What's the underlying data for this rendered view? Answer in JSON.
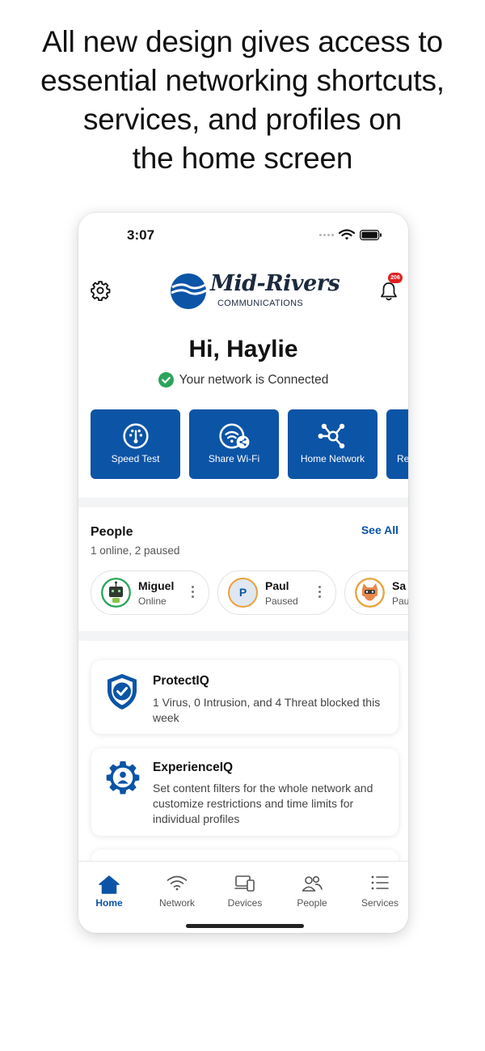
{
  "headline": {
    "lines": [
      "All new design gives access to",
      "essential networking shortcuts,",
      "services, and profiles on",
      "the home screen"
    ]
  },
  "status_bar": {
    "time": "3:07",
    "icons": [
      "signal-dots-icon",
      "wifi-icon",
      "battery-icon"
    ]
  },
  "header": {
    "settings_icon": "gear-icon",
    "logo_text": "Mid-Rivers",
    "logo_subtext": "COMMUNICATIONS",
    "notification_icon": "bell-icon",
    "notification_count": "206"
  },
  "greeting": {
    "title": "Hi, Haylie",
    "network_status": "Your network is Connected",
    "status_icon": "check-circle-icon"
  },
  "shortcuts": [
    {
      "label": "Speed Test",
      "icon": "speedometer-icon"
    },
    {
      "label": "Share Wi-Fi",
      "icon": "share-wifi-icon"
    },
    {
      "label": "Home Network",
      "icon": "network-hub-icon"
    },
    {
      "label": "Re",
      "icon": "partial-tile-icon"
    }
  ],
  "people": {
    "title": "People",
    "see_all": "See All",
    "summary": "1 online, 2 paused",
    "profiles": [
      {
        "name": "Miguel",
        "status": "Online",
        "avatar": "robot-avatar-icon"
      },
      {
        "name": "Paul",
        "status": "Paused",
        "avatar": "initial-avatar",
        "initial": "P"
      },
      {
        "name": "Sa",
        "status": "Pau",
        "avatar": "cat-avatar-icon"
      }
    ]
  },
  "services": [
    {
      "title": "ProtectIQ",
      "description": "1 Virus, 0 Intrusion, and 4 Threat blocked this week",
      "icon": "shield-check-icon"
    },
    {
      "title": "ExperienceIQ",
      "description": "Set content filters for the whole network and customize restrictions and time limits for individual profiles",
      "icon": "gear-person-icon"
    }
  ],
  "tab_bar": {
    "active": "Home",
    "tabs": [
      {
        "label": "Home",
        "icon": "home-icon"
      },
      {
        "label": "Network",
        "icon": "wifi-icon"
      },
      {
        "label": "Devices",
        "icon": "devices-icon"
      },
      {
        "label": "People",
        "icon": "people-icon"
      },
      {
        "label": "Services",
        "icon": "list-icon"
      }
    ]
  },
  "colors": {
    "primary": "#0c54a6",
    "success": "#2aa55b",
    "badge": "#e02020"
  }
}
